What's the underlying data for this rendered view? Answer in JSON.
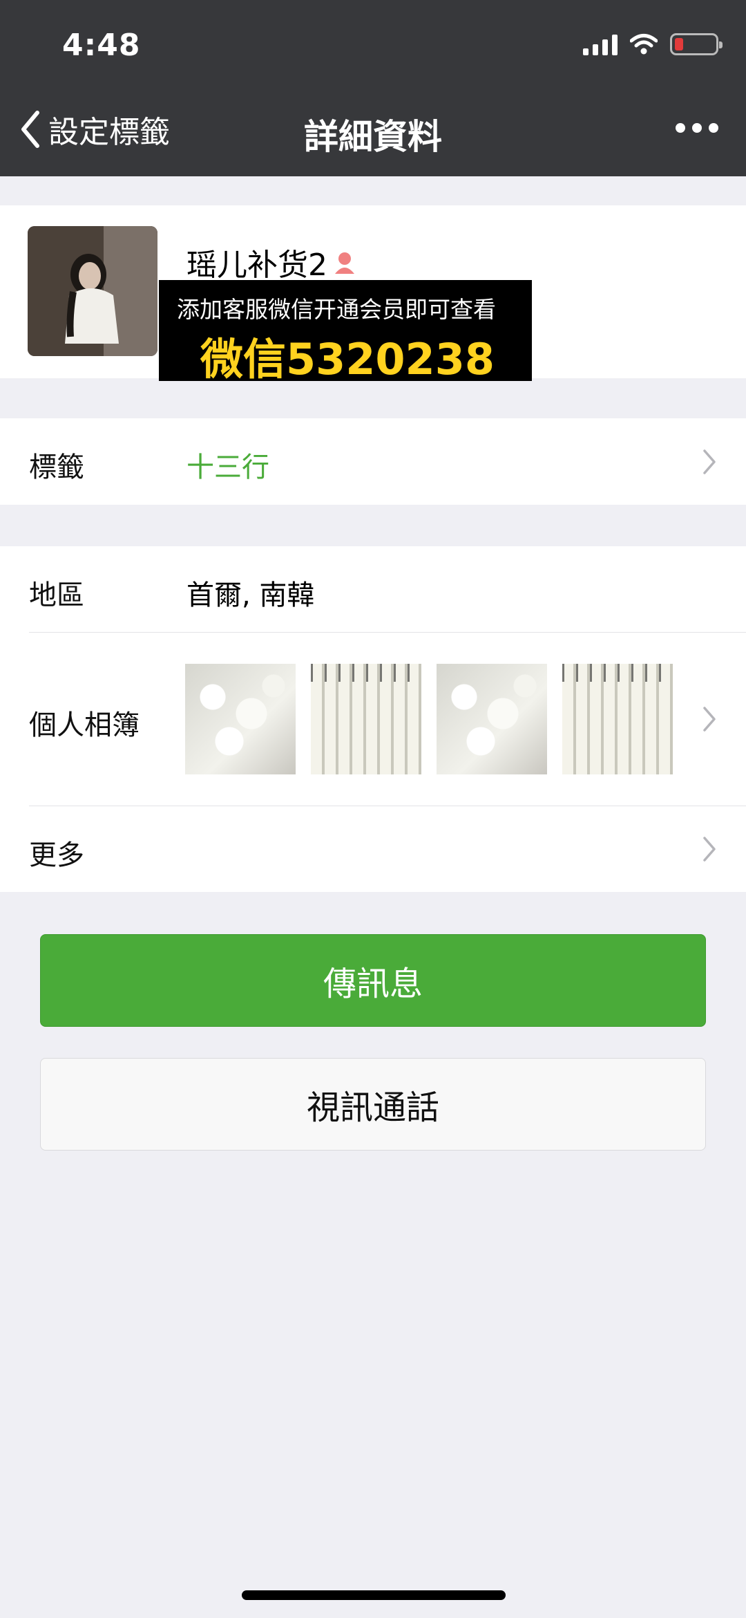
{
  "status_bar": {
    "time": "4:48"
  },
  "nav": {
    "back_label": "設定標籤",
    "title": "詳細資料",
    "more_icon": "ellipsis-icon"
  },
  "profile": {
    "name": "瑶儿补货2",
    "promo_line1": "添加客服微信开通会员即可查看",
    "promo_line2": "微信5320238"
  },
  "tag_row": {
    "label": "標籤",
    "value": "十三行"
  },
  "info": {
    "region_label": "地區",
    "region_value": "首爾, 南韓",
    "album_label": "個人相簿",
    "more_label": "更多"
  },
  "buttons": {
    "message": "傳訊息",
    "video_call": "視訊通話"
  },
  "colors": {
    "header_bg": "#37383b",
    "accent_green": "#4aab39",
    "tag_value_green": "#4aab39",
    "promo_yellow": "#ffd21f",
    "battery_low": "#e23b3b"
  }
}
